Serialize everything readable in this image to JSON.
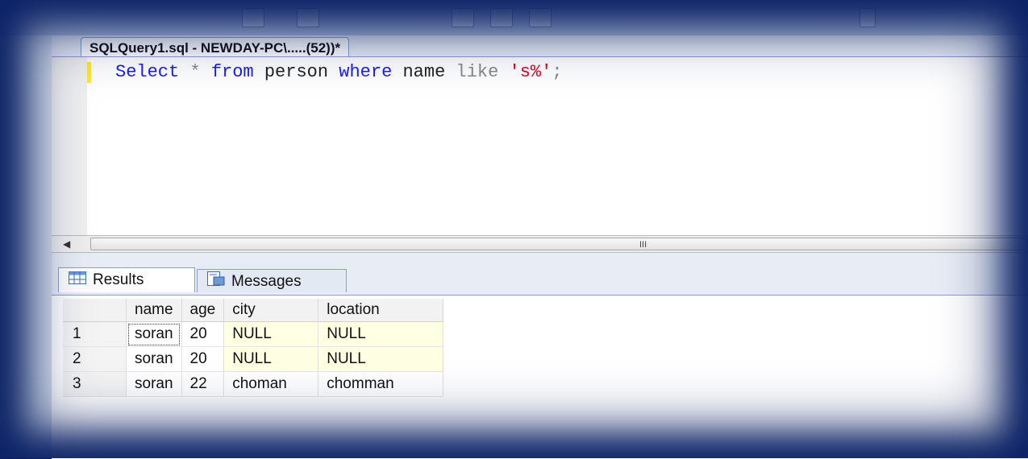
{
  "editor": {
    "tab_title": "SQLQuery1.sql - NEWDAY-PC\\.....(52))*",
    "query": {
      "kw_select": "Select",
      "star": "*",
      "kw_from": "from",
      "table": "person",
      "kw_where": "where",
      "column": "name",
      "kw_like": "like",
      "pattern": "'s%'",
      "terminator": ";"
    },
    "scroll_grip": "III"
  },
  "results": {
    "tabs": [
      {
        "label": "Results",
        "icon": "grid-icon"
      },
      {
        "label": "Messages",
        "icon": "message-icon"
      }
    ],
    "columns": [
      "name",
      "age",
      "city",
      "location"
    ],
    "rows": [
      {
        "num": "1",
        "name": "soran",
        "age": "20",
        "city": "NULL",
        "location": "NULL"
      },
      {
        "num": "2",
        "name": "soran",
        "age": "20",
        "city": "NULL",
        "location": "NULL"
      },
      {
        "num": "3",
        "name": "soran",
        "age": "22",
        "city": "choman",
        "location": "chomman"
      }
    ]
  },
  "colors": {
    "frame": "#0a1f5c",
    "keyword": "#1a1aff",
    "string": "#e0001b",
    "null_cell": "#ffffe3"
  }
}
